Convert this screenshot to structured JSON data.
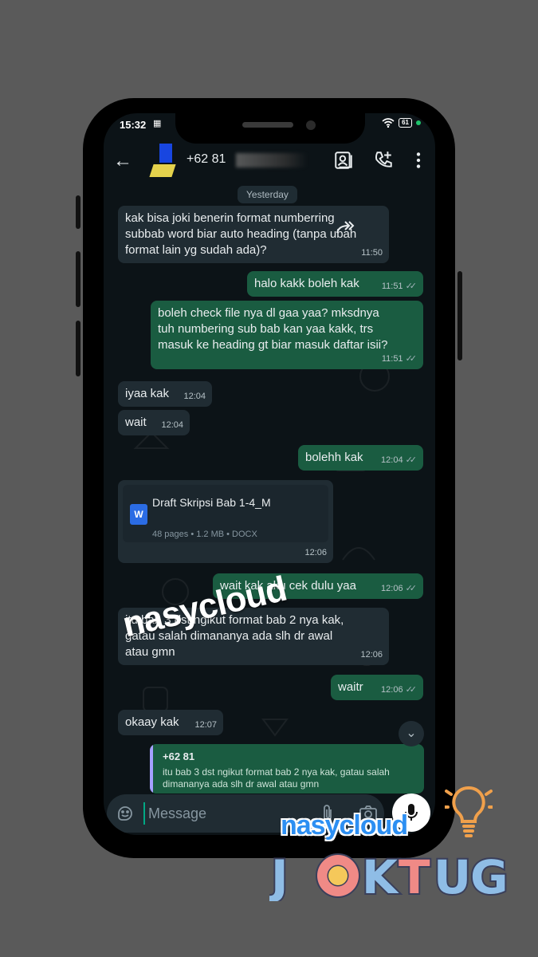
{
  "status": {
    "time": "15:32",
    "battery": "61"
  },
  "header": {
    "contact": "+62 81",
    "back_icon": "arrow-left-icon"
  },
  "day_label": "Yesterday",
  "messages": [
    {
      "dir": "in",
      "text": "kak bisa joki benerin format numberring\nsubbab word biar auto heading (tanpa ubah\nformat lain yg sudah ada)?",
      "time": "11:50"
    },
    {
      "dir": "out",
      "text": "halo kakk boleh kak",
      "time": "11:51"
    },
    {
      "dir": "out",
      "text": "boleh check file nya dl gaa yaa? mksdnya\ntuh numbering sub bab kan yaa kakk, trs\nmasuk ke heading gt biar masuk daftar isii?",
      "time": "11:51"
    },
    {
      "dir": "in",
      "text": "iyaa kak",
      "time": "12:04"
    },
    {
      "dir": "in",
      "text": "wait",
      "time": "12:04"
    },
    {
      "dir": "out",
      "text": "bolehh kak",
      "time": "12:04"
    },
    {
      "dir": "in",
      "text": "wait kak aku cek dulu yaa",
      "time": "12:06"
    },
    {
      "dir": "in",
      "text": "itu bab 3 dst ngikut format bab 2 nya kak,\ngatau salah dimananya ada slh dr awal\natau gmn",
      "time": "12:06"
    },
    {
      "dir": "out",
      "text": "waitr",
      "time": "12:06"
    },
    {
      "dir": "in",
      "text": "okaay kak",
      "time": "12:07"
    }
  ],
  "document": {
    "name": "Draft Skripsi Bab 1-4_M",
    "info": "48 pages • 1.2 MB • DOCX",
    "time": "12:06",
    "icon_label": "W"
  },
  "reply_quote": {
    "name": "+62 81",
    "text": "itu bab 3 dst ngikut format bab 2 nya kak, gatau salah dimananya ada slh dr awal atau gmn"
  },
  "input": {
    "placeholder": "Message"
  },
  "overlay": {
    "watermark": "nasycloud",
    "brand": "nasycloud",
    "logo": "JOKTUG"
  },
  "colors": {
    "incoming": "#202c33",
    "outgoing": "#1a5c41",
    "accent": "#00a884",
    "brand": "#2d8ff2"
  }
}
